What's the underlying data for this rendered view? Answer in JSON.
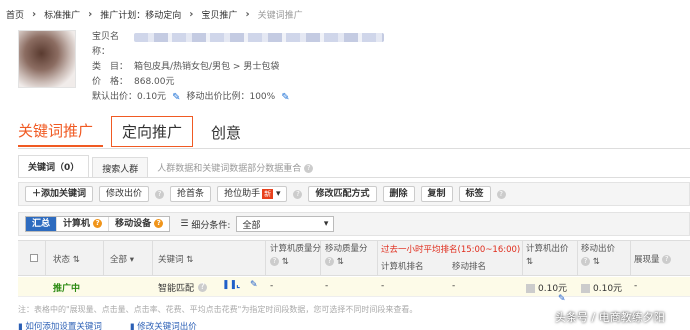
{
  "breadcrumb": [
    "首页",
    "标准推广",
    "推广计划：移动定向",
    "宝贝推广",
    "关键词推广"
  ],
  "product": {
    "name_label": "宝贝名称：",
    "category_label": "类　目：",
    "category_value": "箱包皮具/热销女包/男包 > 男士包袋",
    "price_label": "价　格：",
    "price_value": "868.00元",
    "default_bid_label": "默认出价：",
    "default_bid_value": "0.10元",
    "mobile_ratio_label": "移动出价比例：",
    "mobile_ratio_value": "100%"
  },
  "main_tabs": [
    "关键词推广",
    "定向推广",
    "创意"
  ],
  "sub_tabs": {
    "keyword_tab": "关键词（0）",
    "search_crowd_tab": "搜索人群",
    "note": "人群数据和关键词数据部分数据重合"
  },
  "toolbar": {
    "add_keyword": "添加关键词",
    "edit_bid": "修改出价",
    "rob_top": "抢首条",
    "bid_helper": "抢位助手",
    "new_badge": "新",
    "edit_match": "修改匹配方式",
    "delete": "删除",
    "copy": "复制",
    "tag": "标签"
  },
  "filter": {
    "summary": "汇总",
    "computer": "计算机",
    "mobile": "移动设备",
    "subdivide_label": "细分条件:",
    "select_value": "全部"
  },
  "table": {
    "headers": {
      "status": "状态",
      "all": "全部",
      "keyword": "关键词",
      "pc_quality": "计算机质量分",
      "mobile_quality": "移动质量分",
      "avg_rank": "过去一小时平均排名(15:00~16:00)",
      "pc_rank": "计算机排名",
      "mobile_rank": "移动排名",
      "pc_bid": "计算机出价",
      "mobile_bid": "移动出价",
      "impressions": "展现量"
    },
    "rows": [
      {
        "status": "推广中",
        "keyword": "智能匹配",
        "pc_quality": "-",
        "mobile_quality": "-",
        "pc_rank": "-",
        "mobile_rank": "-",
        "pc_bid": "0.10元",
        "mobile_bid": "0.10元",
        "impressions": "-"
      }
    ]
  },
  "note": "注：表格中的\"展现量、点击量、点击率、花费、平均点击花费\"为指定时间段数据，您可选择不同时间段来查看。",
  "links": [
    "如何添加设置关键词",
    "修改关键词出价"
  ],
  "watermark": "头条号 / 电商教练夕阳",
  "colors": {
    "accent": "#f05a23",
    "blue": "#2d6bbf",
    "status_green": "#2c8a12"
  }
}
